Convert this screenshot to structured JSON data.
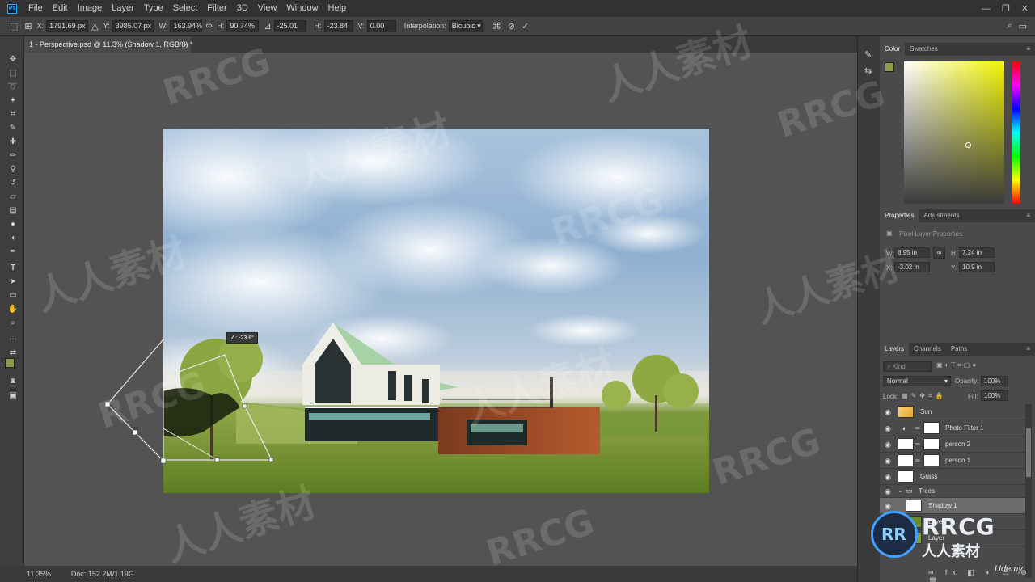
{
  "app": {
    "logo": "Ps",
    "menu": [
      "File",
      "Edit",
      "Image",
      "Layer",
      "Type",
      "Select",
      "Filter",
      "3D",
      "View",
      "Window",
      "Help"
    ],
    "window_controls": [
      "—",
      "❐",
      "✕"
    ]
  },
  "options_bar": {
    "x_label": "X:",
    "x_value": "1791.69 px",
    "y_label": "Y:",
    "y_value": "3985.07 px",
    "w_label": "W:",
    "w_value": "163.94%",
    "h_label": "H:",
    "h_value": "90.74%",
    "angle_value": "-25.01",
    "hskew_label": "H:",
    "hskew_value": "-23.84",
    "vskew_label": "V:",
    "vskew_value": "0.00",
    "interpolation_label": "Interpolation:",
    "interpolation_value": "Bicubic",
    "commit_icon": "check-icon",
    "cancel_icon": "cancel-icon"
  },
  "document": {
    "tab_title": "1 - Perspective.psd @ 11.3% (Shadow 1, RGB/8) *",
    "tab_close": "×",
    "skew_readout": "∠: -23.8°"
  },
  "status": {
    "zoom": "11.35%",
    "doc_size": "Doc: 152.2M/1.19G"
  },
  "color_panel": {
    "tabs": [
      "Color",
      "Swatches"
    ],
    "foreground": "#8f9a4a",
    "background": "#ffffff"
  },
  "properties_panel": {
    "tabs": [
      "Properties",
      "Adjustments"
    ],
    "subtitle": "Pixel Layer Properties",
    "w_label": "W:",
    "w_value": "8.95 in",
    "h_label": "H:",
    "h_value": "7.24 in",
    "x_label": "X:",
    "x_value": "-3.02 in",
    "y_label": "Y:",
    "y_value": "10.9 in"
  },
  "layers_panel": {
    "tabs": [
      "Layers",
      "Channels",
      "Paths"
    ],
    "filter_placeholder": "Kind",
    "blend_mode": "Normal",
    "opacity_label": "Opacity:",
    "opacity_value": "100%",
    "lock_label": "Lock:",
    "fill_label": "Fill:",
    "fill_value": "100%",
    "layers": [
      {
        "name": "Sun"
      },
      {
        "name": "Photo Filter 1"
      },
      {
        "name": "person 2"
      },
      {
        "name": "person 1"
      },
      {
        "name": "Grass"
      },
      {
        "name": "Trees"
      },
      {
        "name": "Shadow 1"
      },
      {
        "name": "Layer"
      },
      {
        "name": "Layer"
      }
    ]
  },
  "watermarks": {
    "brand": "RRCG",
    "cn": "人人素材",
    "udemy": "Udemy"
  }
}
